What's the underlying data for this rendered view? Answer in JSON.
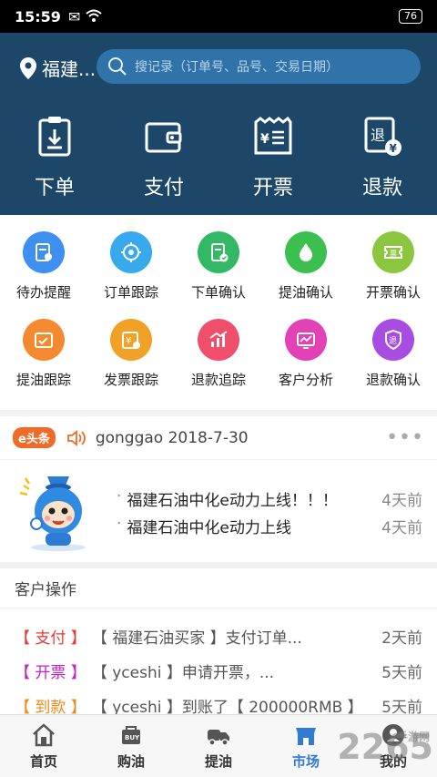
{
  "status": {
    "time": "15:59",
    "battery": "76"
  },
  "header": {
    "location": "福建...",
    "search_placeholder": "搜记录（订单号、品号、交易日期）",
    "actions": [
      {
        "label": "下单",
        "icon": "clipboard-download-icon"
      },
      {
        "label": "支付",
        "icon": "wallet-icon"
      },
      {
        "label": "开票",
        "icon": "invoice-icon"
      },
      {
        "label": "退款",
        "icon": "refund-icon"
      }
    ]
  },
  "grid": [
    {
      "label": "待办提醒",
      "icon": "reminder-icon",
      "color": "#3d8ff0"
    },
    {
      "label": "订单跟踪",
      "icon": "track-icon",
      "color": "#38a9ec"
    },
    {
      "label": "下单确认",
      "icon": "order-confirm-icon",
      "color": "#33b865"
    },
    {
      "label": "提油确认",
      "icon": "oil-drop-icon",
      "color": "#3bbf4f"
    },
    {
      "label": "开票确认",
      "icon": "ticket-confirm-icon",
      "color": "#8cc63f"
    },
    {
      "label": "提油跟踪",
      "icon": "oil-track-icon",
      "color": "#f48a2f"
    },
    {
      "label": "发票跟踪",
      "icon": "invoice-track-icon",
      "color": "#f1a126"
    },
    {
      "label": "退款追踪",
      "icon": "chart-icon",
      "color": "#ef4f6a"
    },
    {
      "label": "客户分析",
      "icon": "analysis-icon",
      "color": "#e342b6"
    },
    {
      "label": "退款确认",
      "icon": "refund-confirm-icon",
      "color": "#a84de1"
    }
  ],
  "news": {
    "badge": "e头条",
    "notice": "gonggao 2018-7-30",
    "items": [
      {
        "title": "福建石油中化e动力上线！！！",
        "ago": "4天前"
      },
      {
        "title": "福建石油中化e动力上线",
        "ago": "4天前"
      }
    ]
  },
  "ops": {
    "title": "客户操作",
    "items": [
      {
        "tag": "【 支付 】",
        "color": "#e53935",
        "text": "【 福建石油买家 】支付订单...",
        "ago": "2天前"
      },
      {
        "tag": "【 开票 】",
        "color": "#c51fc5",
        "text": "【 yceshi 】申请开票，...",
        "ago": "5天前"
      },
      {
        "tag": "【 到款 】",
        "color": "#f08a16",
        "text": "【 yceshi 】到账了【 200000RMB 】",
        "ago": "5天前"
      }
    ]
  },
  "tabs": [
    {
      "label": "首页",
      "icon": "home-icon"
    },
    {
      "label": "购油",
      "icon": "buy-oil-icon"
    },
    {
      "label": "提油",
      "icon": "truck-icon"
    },
    {
      "label": "市场",
      "icon": "market-icon"
    },
    {
      "label": "我的",
      "icon": "user-icon"
    }
  ],
  "watermark": {
    "number": "2265",
    "text": "手游网"
  },
  "colors": {
    "header": "#1d4768",
    "search": "#2f73a8",
    "active_tab": "#2f7ad2"
  }
}
